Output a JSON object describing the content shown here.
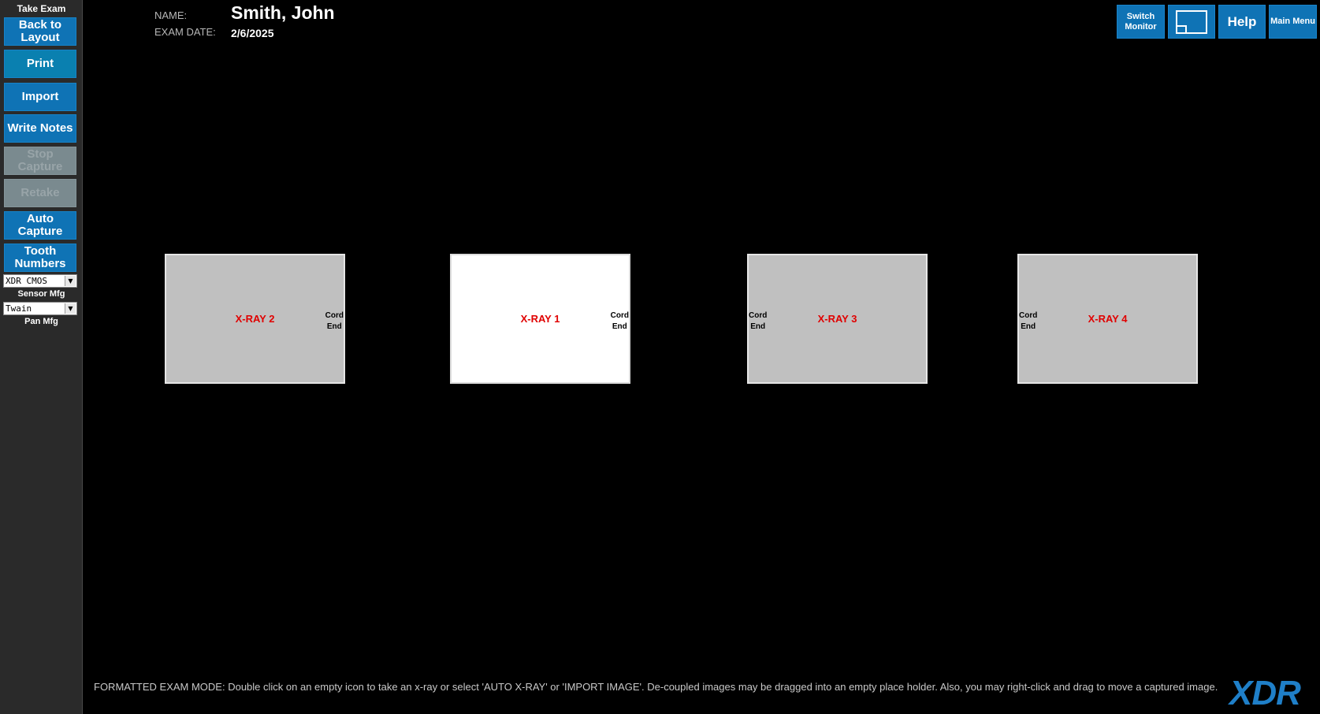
{
  "sidebar": {
    "title": "Take Exam",
    "buttons": {
      "back_to_layout": "Back to Layout",
      "print": "Print",
      "import": "Import",
      "write_notes": "Write Notes",
      "stop_capture": "Stop Capture",
      "retake": "Retake",
      "auto_capture": "Auto Capture",
      "tooth_numbers": "Tooth Numbers"
    },
    "sensor_select": {
      "value": "XDR CMOS",
      "caption": "Sensor Mfg"
    },
    "pan_select": {
      "value": "Twain",
      "caption": "Pan Mfg"
    },
    "disabled_buttons": [
      "Stop Capture",
      "Retake"
    ]
  },
  "header": {
    "name_label": "NAME:",
    "name": "Smith, John",
    "date_label": "EXAM DATE:",
    "date": "2/6/2025"
  },
  "topbar": {
    "switch_monitor": "Switch Monitor",
    "monitor_icon": "monitor-icon",
    "help": "Help",
    "main_menu": "Main Menu"
  },
  "xrays": [
    {
      "label": "X-RAY 2",
      "cord_line1": "Cord",
      "cord_line2": "End",
      "cord_side": "right",
      "selected": false
    },
    {
      "label": "X-RAY 1",
      "cord_line1": "Cord",
      "cord_line2": "End",
      "cord_side": "right",
      "selected": true
    },
    {
      "label": "X-RAY 3",
      "cord_line1": "Cord",
      "cord_line2": "End",
      "cord_side": "left",
      "selected": false
    },
    {
      "label": "X-RAY 4",
      "cord_line1": "Cord",
      "cord_line2": "End",
      "cord_side": "left",
      "selected": false
    }
  ],
  "footer": {
    "message": "FORMATTED EXAM MODE: Double click on an empty icon to take an x-ray or select 'AUTO X-RAY' or 'IMPORT IMAGE'. De-coupled images may be dragged into an empty place holder. Also, you may right-click and drag to move a captured image.",
    "logo": "XDR"
  },
  "colors": {
    "button_blue": "#0f73b5",
    "disabled_gray": "#7a8a8f",
    "xray_label_red": "#e00000",
    "logo_blue": "#1f7fc8",
    "background": "#000000"
  }
}
